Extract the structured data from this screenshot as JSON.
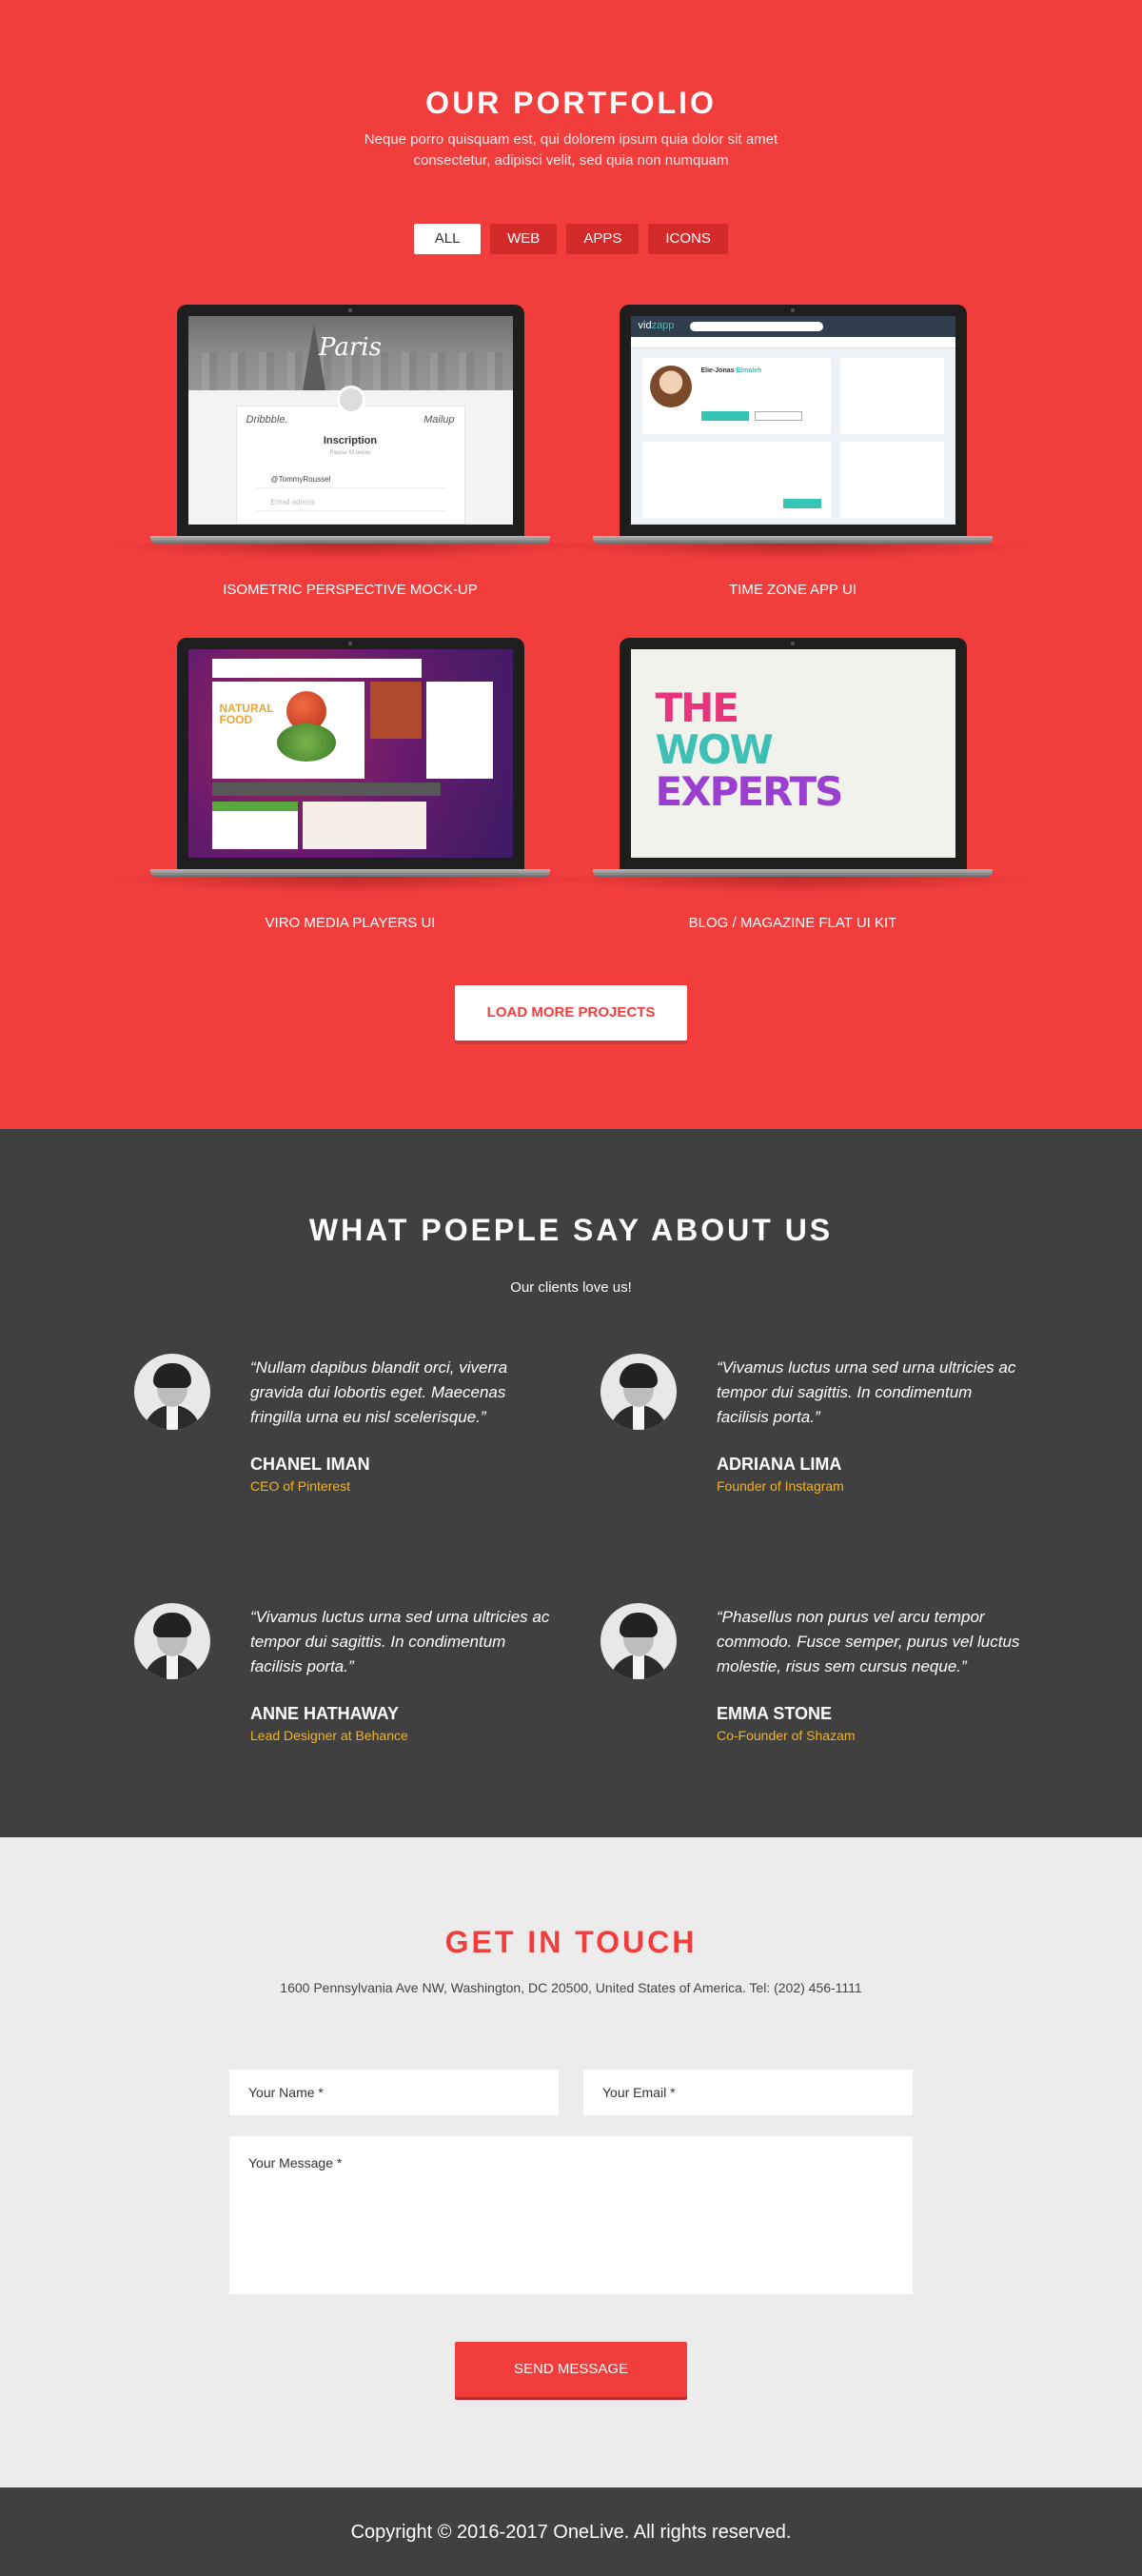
{
  "portfolio": {
    "title": "OUR PORTFOLIO",
    "subtitle": "Neque porro quisquam est, qui dolorem ipsum quia dolor sit amet consectetur, adipisci velit, sed quia non numquam",
    "filters": [
      "ALL",
      "WEB",
      "APPS",
      "ICONS"
    ],
    "active_filter": "ALL",
    "items": [
      {
        "caption": "ISOMETRIC PERSPECTIVE MOCK-UP",
        "screen": {
          "city": "Paris",
          "brand_left": "Dribbble.",
          "brand_right": "Mailup",
          "heading": "Inscription",
          "sub": "Please fill below",
          "field_user": "@TommyRoussel",
          "field_mail": "Email adress"
        }
      },
      {
        "caption": "TIME ZONE APP UI",
        "screen": {
          "logo_a": "vid",
          "logo_b": "zapp",
          "name_a": "Elie-Jonas",
          "name_b": "Elmaleh"
        }
      },
      {
        "caption": "VIRO MEDIA PLAYERS UI",
        "screen": {
          "food_line1": "NATURAL",
          "food_line2": "FOOD"
        }
      },
      {
        "caption": "BLOG / MAGAZINE FLAT UI KIT",
        "screen": {
          "line1": "THE",
          "line2": "WOW",
          "line3": "EXPERTS"
        }
      }
    ],
    "load_more": "LOAD MORE PROJECTS",
    "colors": {
      "background": "#f23d3d",
      "filter_bg": "#d42a2a"
    }
  },
  "testimonials": {
    "title": "WHAT POEPLE SAY ABOUT US",
    "subtitle": "Our clients love us!",
    "items": [
      {
        "quote": "“Nullam dapibus blandit orci, viverra gravida dui lobortis eget. Maecenas fringilla urna eu nisl scelerisque.”",
        "name": "CHANEL IMAN",
        "role": "CEO of Pinterest"
      },
      {
        "quote": "“Vivamus luctus urna sed urna ultricies ac tempor dui sagittis. In condimentum facilisis porta.”",
        "name": "ADRIANA LIMA",
        "role": "Founder of Instagram"
      },
      {
        "quote": "“Vivamus luctus urna sed urna ultricies ac tempor dui sagittis. In condimentum facilisis porta.”",
        "name": "ANNE HATHAWAY",
        "role": "Lead Designer at Behance"
      },
      {
        "quote": "“Phasellus non purus vel arcu tempor commodo. Fusce semper, purus vel luctus molestie, risus sem cursus neque.”",
        "name": "EMMA STONE",
        "role": "Co-Founder of Shazam"
      }
    ],
    "colors": {
      "background": "#404040",
      "role": "#f6b21c"
    }
  },
  "contact": {
    "title": "GET IN TOUCH",
    "address": "1600 Pennsylvania Ave NW, Washington, DC 20500, United States of America. Tel: (202) 456-1111",
    "name_placeholder": "Your Name *",
    "email_placeholder": "Your Email *",
    "message_placeholder": "Your Message *",
    "send_label": "SEND MESSAGE",
    "colors": {
      "title": "#f23d3d",
      "background": "#ececec"
    }
  },
  "footer": {
    "copyright": "Copyright © 2016-2017 OneLive. All rights reserved."
  }
}
